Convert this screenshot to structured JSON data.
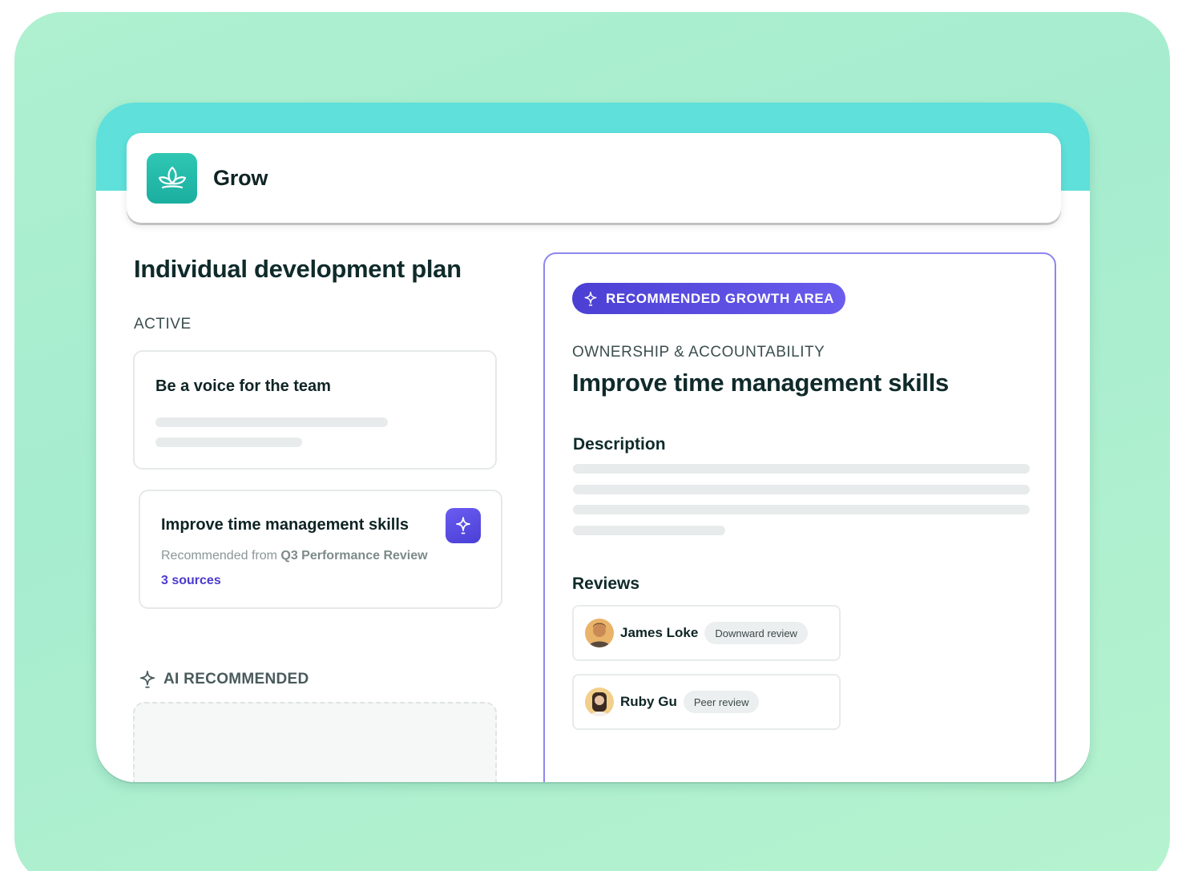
{
  "app": {
    "name": "Grow",
    "logo_icon": "lotus-icon",
    "accent": "#1fb3a3"
  },
  "plan": {
    "title": "Individual development plan",
    "active_label": "ACTIVE",
    "goals": [
      {
        "title": "Be a voice for the team"
      },
      {
        "title": "Improve time management skills",
        "recommended_prefix": "Recommended from ",
        "recommended_source": "Q3 Performance Review",
        "sources_link": "3 sources",
        "badge_icon": "sparkle-icon"
      }
    ],
    "ai_recommended_label": "AI RECOMMENDED"
  },
  "detail": {
    "pill_label": "RECOMMENDED GROWTH AREA",
    "category": "OWNERSHIP & ACCOUNTABILITY",
    "title": "Improve time management skills",
    "description_heading": "Description",
    "reviews_heading": "Reviews",
    "reviews": [
      {
        "name": "James Loke",
        "type": "Downward review"
      },
      {
        "name": "Ruby Gu",
        "type": "Peer review"
      }
    ]
  },
  "colors": {
    "pill": "#5446e0",
    "panel_border": "#8e86ef",
    "link": "#4a3ad0",
    "backdrop": "#aef0d0",
    "window_band": "#5fe0da"
  }
}
